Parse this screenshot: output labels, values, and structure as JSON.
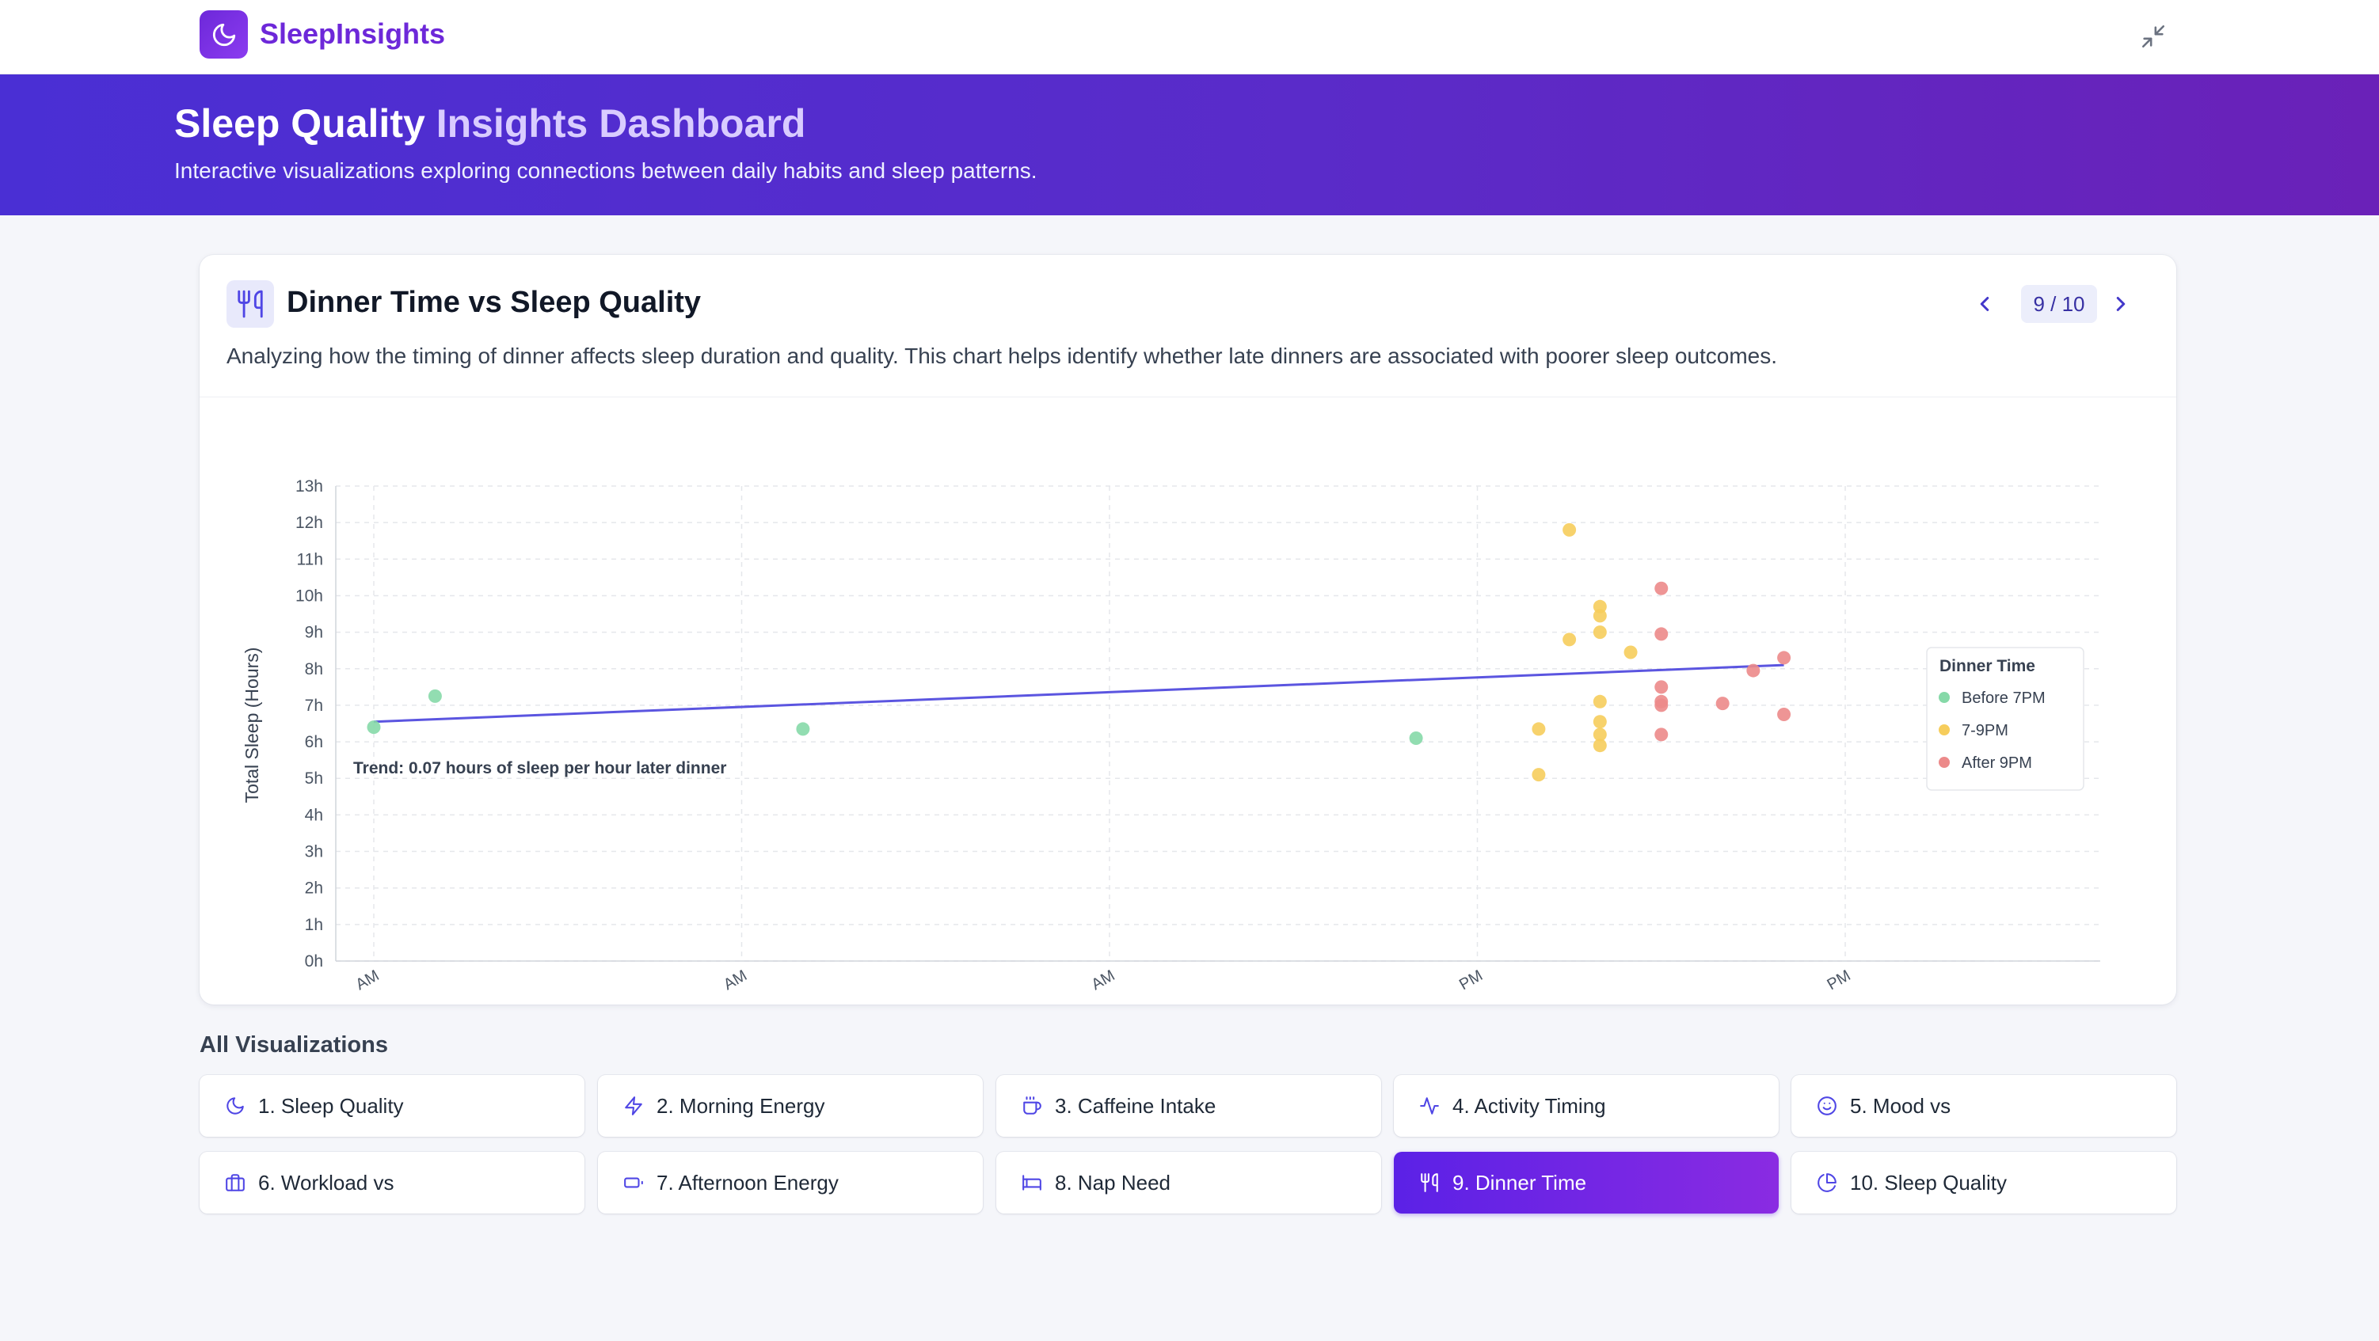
{
  "app": {
    "name": "SleepInsights"
  },
  "hero": {
    "title_main": "Sleep Quality",
    "title_accent": "Insights Dashboard",
    "subtitle": "Interactive visualizations exploring connections between daily habits and sleep patterns."
  },
  "card": {
    "title": "Dinner Time vs Sleep Quality",
    "description": "Analyzing how the timing of dinner affects sleep duration and quality. This chart helps identify whether late dinners are associated with poorer sleep outcomes.",
    "pager": "9 / 10",
    "icon": "utensils-icon"
  },
  "chart_data": {
    "type": "scatter",
    "ylabel": "Total Sleep (Hours)",
    "ylim": [
      0,
      13
    ],
    "y_ticks": [
      "0h",
      "1h",
      "2h",
      "3h",
      "4h",
      "5h",
      "6h",
      "7h",
      "8h",
      "9h",
      "10h",
      "11h",
      "12h",
      "13h"
    ],
    "x_ticks": [
      "AM",
      "AM",
      "AM",
      "PM",
      "PM"
    ],
    "xlim": [
      12,
      24
    ],
    "grid": true,
    "annotation": "Trend: 0.07 hours of sleep per hour later dinner",
    "legend": {
      "title": "Dinner Time",
      "position": "top-right"
    },
    "series": [
      {
        "name": "Before 7PM",
        "color": "#86d9a8",
        "points": [
          [
            12.0,
            6.4
          ],
          [
            12.5,
            7.25
          ],
          [
            15.5,
            6.35
          ],
          [
            20.5,
            6.1
          ]
        ]
      },
      {
        "name": "7-9PM",
        "color": "#f6cd5c",
        "points": [
          [
            21.5,
            6.35
          ],
          [
            21.5,
            5.1
          ],
          [
            21.75,
            11.8
          ],
          [
            21.75,
            8.8
          ],
          [
            22.0,
            9.7
          ],
          [
            22.0,
            9.45
          ],
          [
            22.0,
            9.0
          ],
          [
            22.0,
            7.1
          ],
          [
            22.0,
            6.55
          ],
          [
            22.0,
            6.2
          ],
          [
            22.0,
            5.9
          ],
          [
            22.25,
            8.45
          ]
        ]
      },
      {
        "name": "After 9PM",
        "color": "#ec8a8a",
        "points": [
          [
            22.5,
            10.2
          ],
          [
            22.5,
            8.95
          ],
          [
            22.5,
            7.5
          ],
          [
            22.5,
            7.1
          ],
          [
            22.5,
            7.0
          ],
          [
            22.5,
            6.2
          ],
          [
            23.0,
            7.05
          ],
          [
            23.25,
            7.95
          ],
          [
            23.5,
            8.3
          ],
          [
            23.5,
            6.75
          ]
        ]
      }
    ],
    "trend": {
      "from": [
        12.0,
        6.55
      ],
      "to": [
        23.5,
        8.1
      ],
      "color": "#5b55e0"
    }
  },
  "gallery": {
    "title": "All Visualizations",
    "items": [
      {
        "label": "1. Sleep Quality",
        "icon": "moon-icon"
      },
      {
        "label": "2. Morning Energy",
        "icon": "bolt-icon"
      },
      {
        "label": "3. Caffeine Intake",
        "icon": "coffee-icon"
      },
      {
        "label": "4. Activity Timing",
        "icon": "activity-icon"
      },
      {
        "label": "5. Mood vs",
        "icon": "smile-icon"
      },
      {
        "label": "6. Workload vs",
        "icon": "briefcase-icon"
      },
      {
        "label": "7. Afternoon Energy",
        "icon": "battery-icon"
      },
      {
        "label": "8. Nap Need",
        "icon": "bed-icon"
      },
      {
        "label": "9. Dinner Time",
        "icon": "utensils-icon",
        "active": true
      },
      {
        "label": "10. Sleep Quality",
        "icon": "pie-chart-icon"
      }
    ]
  }
}
